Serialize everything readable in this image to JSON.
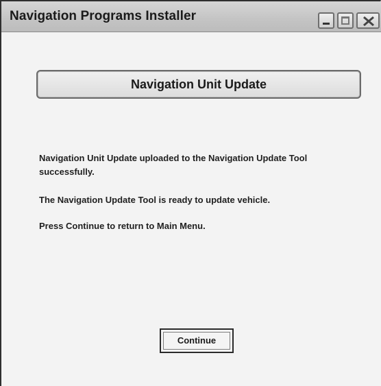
{
  "window": {
    "title": "Navigation Programs Installer",
    "controls": {
      "minimize_icon": "minimize-icon",
      "maximize_icon": "maximize-icon",
      "close_icon": "close-icon"
    }
  },
  "header": {
    "title": "Navigation Unit Update"
  },
  "messages": [
    "Navigation Unit Update uploaded to the Navigation Update Tool successfully.",
    "The Navigation Update Tool is ready to update vehicle.",
    "Press Continue to return to Main Menu."
  ],
  "buttons": {
    "continue_label": "Continue"
  }
}
